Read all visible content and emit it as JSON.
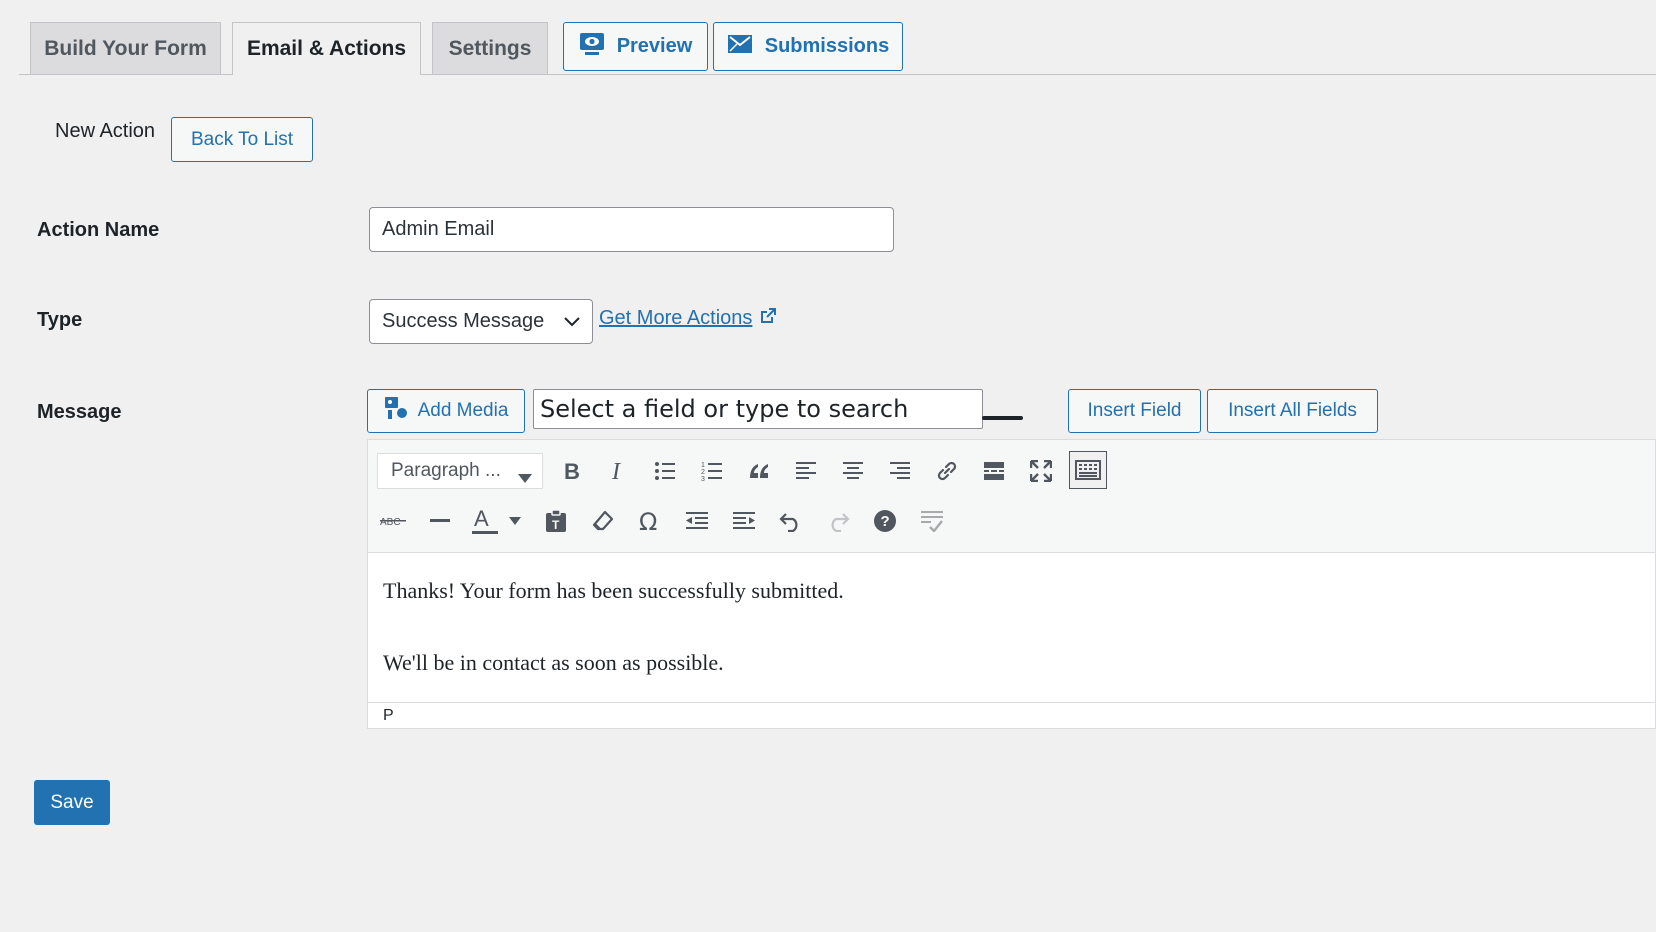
{
  "tabs": [
    {
      "label": "Build Your Form"
    },
    {
      "label": "Email & Actions"
    },
    {
      "label": "Settings"
    }
  ],
  "tab_buttons": {
    "preview": "Preview",
    "submissions": "Submissions"
  },
  "header": {
    "title": "New Action",
    "back_button": "Back To List"
  },
  "form": {
    "action_name_label": "Action Name",
    "action_name_value": "Admin Email",
    "type_label": "Type",
    "type_value": "Success Message",
    "get_more_link": "Get More Actions",
    "message_label": "Message"
  },
  "editor_controls": {
    "add_media": "Add Media",
    "field_search_placeholder": "Select a field or type to search",
    "insert_field": "Insert Field",
    "insert_all_fields": "Insert All Fields",
    "format_select": "Paragraph ..."
  },
  "editor": {
    "paragraph_1": "Thanks! Your form has been successfully submitted.",
    "paragraph_2": "We'll be in contact as soon as possible.",
    "path": "P"
  },
  "toolbar_row1_icons": [
    "bold-icon",
    "italic-icon",
    "bullet-list-icon",
    "numbered-list-icon",
    "blockquote-icon",
    "align-left-icon",
    "align-center-icon",
    "align-right-icon",
    "link-icon",
    "read-more-icon",
    "fullscreen-icon",
    "toolbar-toggle-icon"
  ],
  "toolbar_row2_icons": [
    "strikethrough-icon",
    "horizontal-line-icon",
    "text-color-icon",
    "paste-text-icon",
    "clear-formatting-icon",
    "special-character-icon",
    "outdent-icon",
    "indent-icon",
    "undo-icon",
    "redo-icon",
    "help-icon",
    "remove-format-icon"
  ],
  "footer": {
    "save_button": "Save"
  },
  "colors": {
    "accent": "#2271b1",
    "background": "#f0f0f1"
  }
}
